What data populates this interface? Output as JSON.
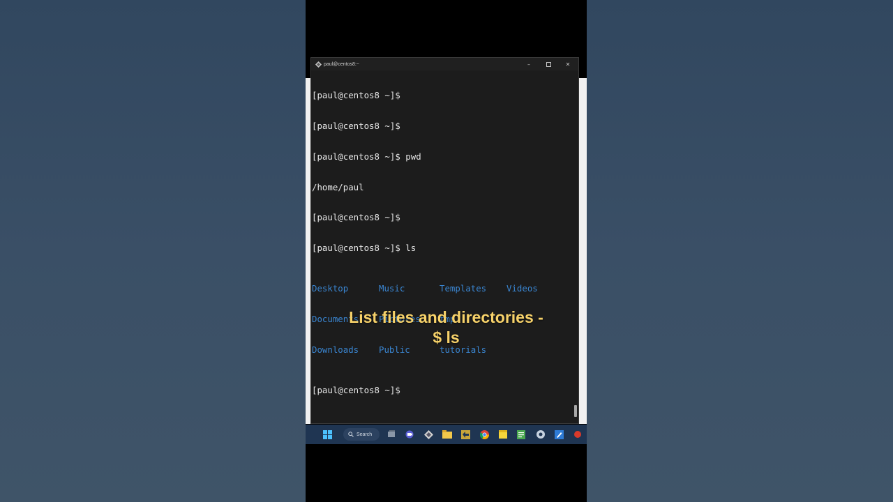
{
  "window": {
    "title": "paul@centos8:~"
  },
  "terminal": {
    "lines_before": [
      "[paul@centos8 ~]$",
      "[paul@centos8 ~]$",
      "[paul@centos8 ~]$ pwd",
      "/home/paul",
      "[paul@centos8 ~]$",
      "[paul@centos8 ~]$ ls"
    ],
    "ls_rows": [
      [
        "Desktop",
        "Music",
        "Templates",
        "Videos"
      ],
      [
        "Documents",
        "Pictures",
        "tmp",
        ""
      ],
      [
        "Downloads",
        "Public",
        "tutorials",
        ""
      ]
    ],
    "lines_after": [
      "[paul@centos8 ~]$"
    ],
    "directory_color": "#3a86d2"
  },
  "caption": {
    "line1": "List files and directories -",
    "line2": "$ ls",
    "color": "#f7d26a"
  },
  "taskbar": {
    "search_label": "Search",
    "icons": [
      "windows-start-icon",
      "search-icon",
      "task-view-icon",
      "meet-icon",
      "putty-icon",
      "file-explorer-icon",
      "winscp-icon",
      "chrome-icon",
      "sticky-notes-icon",
      "notepad-icon",
      "settings-icon",
      "paint-icon",
      "record-icon"
    ]
  }
}
